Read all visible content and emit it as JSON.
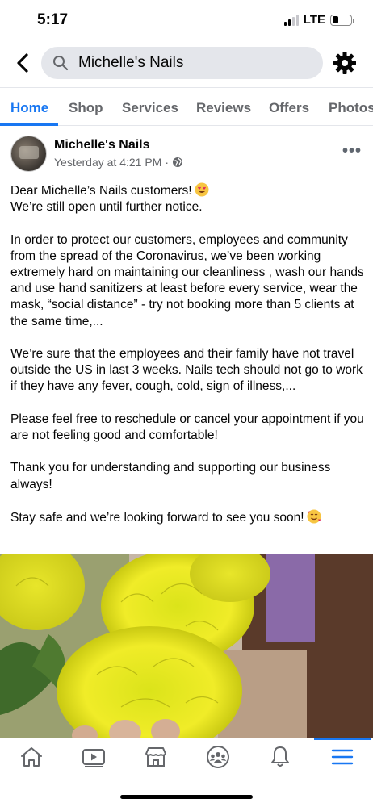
{
  "status_bar": {
    "time": "5:17",
    "network": "LTE",
    "signal_bars": 2,
    "battery_level": 0.35
  },
  "header": {
    "search_text": "Michelle's Nails"
  },
  "tabs": [
    {
      "label": "Home",
      "active": true
    },
    {
      "label": "Shop"
    },
    {
      "label": "Services"
    },
    {
      "label": "Reviews"
    },
    {
      "label": "Offers"
    },
    {
      "label": "Photos"
    }
  ],
  "post": {
    "author": "Michelle's Nails",
    "timestamp": "Yesterday at 4:21 PM",
    "separator": "·",
    "audience_icon": "globe-icon",
    "paragraphs": [
      "Dear Michelle’s Nails customers!",
      "We’re still open until further notice.",
      "In order to protect our customers, employees and community from the spread of the Coronavirus, we’ve been working extremely hard on maintaining our cleanliness , wash our hands and use hand sanitizers at least before every service, wear the mask, “social distance” - try not booking more than 5 clients at the same time,...",
      "We’re sure that the employees and their family have not travel outside the US in last 3 weeks. Nails tech should not go to work if they have any fever, cough, cold, sign of illness,...",
      "Please feel free to reschedule or cancel your appointment if you are not feeling good and comfortable!",
      "Thank you for understanding and supporting our business always!",
      "Stay safe and we’re looking forward to see you soon!"
    ],
    "emojis": [
      "heart-eyes-emoji",
      "smiling-hearts-emoji"
    ],
    "photo": "yellow-chrysanthemum-photo"
  },
  "bottom_nav": [
    {
      "icon": "home-icon"
    },
    {
      "icon": "video-icon"
    },
    {
      "icon": "marketplace-icon"
    },
    {
      "icon": "groups-icon"
    },
    {
      "icon": "bell-icon"
    },
    {
      "icon": "menu-icon",
      "active": true
    }
  ],
  "colors": {
    "accent": "#1877f2",
    "secondary_text": "#65676b",
    "search_bg": "#e4e6eb"
  }
}
